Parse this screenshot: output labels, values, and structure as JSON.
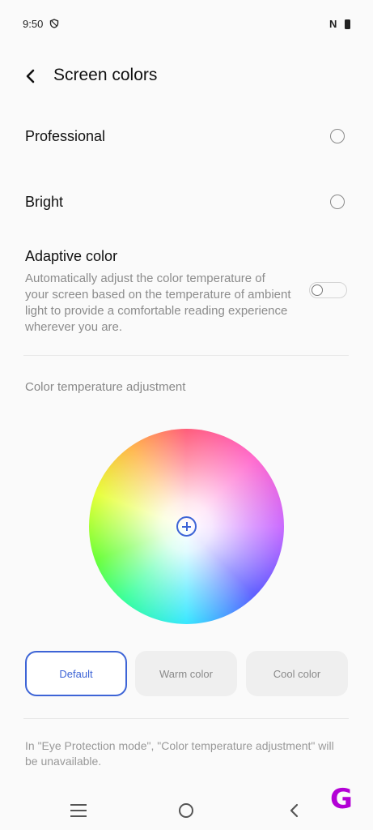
{
  "status_bar": {
    "time": "9:50",
    "nfc": "N",
    "icons": [
      "shield-icon",
      "nfc-icon",
      "battery-icon"
    ]
  },
  "header": {
    "title": "Screen colors",
    "back_icon": "chevron-left-icon"
  },
  "options": [
    {
      "label": "Professional",
      "selected": false
    },
    {
      "label": "Bright",
      "selected": false
    }
  ],
  "adaptive": {
    "title": "Adaptive color",
    "description": "Automatically adjust the color temperature of your screen based on the temperature of ambient light to provide a comfortable reading experience wherever you are.",
    "enabled": false
  },
  "color_temp": {
    "label": "Color temperature adjustment",
    "presets": [
      {
        "label": "Default",
        "selected": true
      },
      {
        "label": "Warm color",
        "selected": false
      },
      {
        "label": "Cool color",
        "selected": false
      }
    ],
    "accent": "#3d64d6"
  },
  "note": "In \"Eye Protection mode\", \"Color temperature adjustment\" will be unavailable.",
  "nav_bar": {
    "icons": [
      "menu-icon",
      "home-icon",
      "back-icon"
    ]
  },
  "watermark": "G"
}
